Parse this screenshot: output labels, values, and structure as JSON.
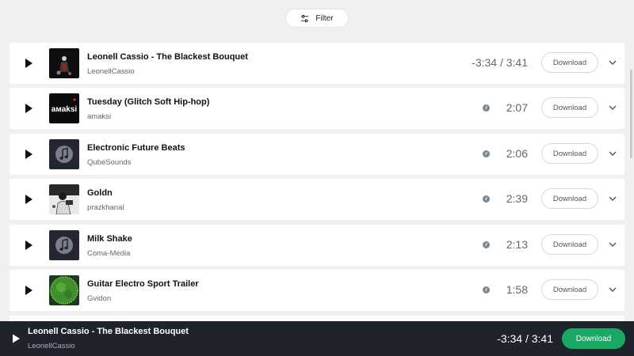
{
  "filter": {
    "label": "Filter",
    "icon": "sliders-icon"
  },
  "tracks": [
    {
      "title": "Leonell Cassio - The Blackest Bouquet",
      "artist": "LeonellCassio",
      "duration": "-3:34 / 3:41",
      "download_label": "Download",
      "playing": true
    },
    {
      "title": "Tuesday (Glitch Soft Hip-hop)",
      "artist": "amaksi",
      "duration": "2:07",
      "download_label": "Download",
      "cover_text": "aмaksi"
    },
    {
      "title": "Electronic Future Beats",
      "artist": "QubeSounds",
      "duration": "2:06",
      "download_label": "Download"
    },
    {
      "title": "Goldn",
      "artist": "prazkhanal",
      "duration": "2:39",
      "download_label": "Download"
    },
    {
      "title": "Milk Shake",
      "artist": "Coma-Media",
      "duration": "2:13",
      "download_label": "Download"
    },
    {
      "title": "Guitar Electro Sport Trailer",
      "artist": "Gvidon",
      "duration": "1:58",
      "download_label": "Download"
    }
  ],
  "player": {
    "title": "Leonell Cassio - The Blackest Bouquet",
    "artist": "LeonellCassio",
    "time": "-3:34 / 3:41",
    "download_label": "Download"
  },
  "colors": {
    "accent": "#1aa965",
    "player_bg": "#1f232b",
    "page_bg": "#f0f0f0"
  }
}
